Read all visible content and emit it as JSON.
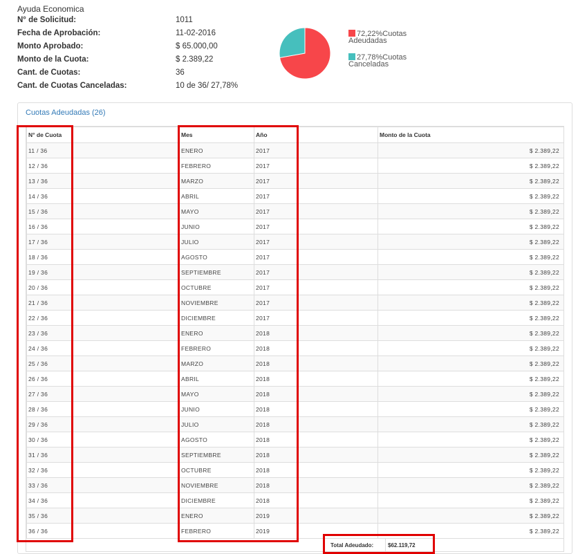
{
  "info": {
    "title": "Ayuda Economica",
    "rows": [
      {
        "label": "N° de Solicitud:",
        "value": "1011"
      },
      {
        "label": "Fecha de Aprobación:",
        "value": "11-02-2016"
      },
      {
        "label": "Monto Aprobado:",
        "value": "$ 65.000,00"
      },
      {
        "label": "Monto de la Cuota:",
        "value": "$ 2.389,22"
      },
      {
        "label": "Cant. de Cuotas:",
        "value": "36"
      },
      {
        "label": "Cant. de Cuotas Canceladas:",
        "value": "10 de 36/ 27,78%"
      }
    ]
  },
  "chart_data": {
    "type": "pie",
    "slices": [
      {
        "label": "Cuotas Adeudadas",
        "value": 72.22,
        "color": "#f7464a"
      },
      {
        "label": "Cuotas Canceladas",
        "value": 27.78,
        "color": "#46bfbd"
      }
    ],
    "legend": [
      {
        "line1": "72,22%Cuotas",
        "line2": "Adeudadas"
      },
      {
        "line1": "27,78%Cuotas",
        "line2": "Canceladas"
      }
    ]
  },
  "panel": {
    "heading": "Cuotas Adeudadas (26)"
  },
  "table": {
    "headers": [
      "N° de Cuota",
      "Mes",
      "Año",
      "Monto de la Cuota"
    ],
    "rows": [
      [
        "11 / 36",
        "ENERO",
        "2017",
        "$ 2.389,22"
      ],
      [
        "12 / 36",
        "FEBRERO",
        "2017",
        "$ 2.389,22"
      ],
      [
        "13 / 36",
        "MARZO",
        "2017",
        "$ 2.389,22"
      ],
      [
        "14 / 36",
        "ABRIL",
        "2017",
        "$ 2.389,22"
      ],
      [
        "15 / 36",
        "MAYO",
        "2017",
        "$ 2.389,22"
      ],
      [
        "16 / 36",
        "JUNIO",
        "2017",
        "$ 2.389,22"
      ],
      [
        "17 / 36",
        "JULIO",
        "2017",
        "$ 2.389,22"
      ],
      [
        "18 / 36",
        "AGOSTO",
        "2017",
        "$ 2.389,22"
      ],
      [
        "19 / 36",
        "SEPTIEMBRE",
        "2017",
        "$ 2.389,22"
      ],
      [
        "20 / 36",
        "OCTUBRE",
        "2017",
        "$ 2.389,22"
      ],
      [
        "21 / 36",
        "NOVIEMBRE",
        "2017",
        "$ 2.389,22"
      ],
      [
        "22 / 36",
        "DICIEMBRE",
        "2017",
        "$ 2.389,22"
      ],
      [
        "23 / 36",
        "ENERO",
        "2018",
        "$ 2.389,22"
      ],
      [
        "24 / 36",
        "FEBRERO",
        "2018",
        "$ 2.389,22"
      ],
      [
        "25 / 36",
        "MARZO",
        "2018",
        "$ 2.389,22"
      ],
      [
        "26 / 36",
        "ABRIL",
        "2018",
        "$ 2.389,22"
      ],
      [
        "27 / 36",
        "MAYO",
        "2018",
        "$ 2.389,22"
      ],
      [
        "28 / 36",
        "JUNIO",
        "2018",
        "$ 2.389,22"
      ],
      [
        "29 / 36",
        "JULIO",
        "2018",
        "$ 2.389,22"
      ],
      [
        "30 / 36",
        "AGOSTO",
        "2018",
        "$ 2.389,22"
      ],
      [
        "31 / 36",
        "SEPTIEMBRE",
        "2018",
        "$ 2.389,22"
      ],
      [
        "32 / 36",
        "OCTUBRE",
        "2018",
        "$ 2.389,22"
      ],
      [
        "33 / 36",
        "NOVIEMBRE",
        "2018",
        "$ 2.389,22"
      ],
      [
        "34 / 36",
        "DICIEMBRE",
        "2018",
        "$ 2.389,22"
      ],
      [
        "35 / 36",
        "ENERO",
        "2019",
        "$ 2.389,22"
      ],
      [
        "36 / 36",
        "FEBRERO",
        "2019",
        "$ 2.389,22"
      ]
    ],
    "total_label": "Total Adeudado:",
    "total_value": "$62.119,72"
  },
  "highlight_color": "#e00000"
}
